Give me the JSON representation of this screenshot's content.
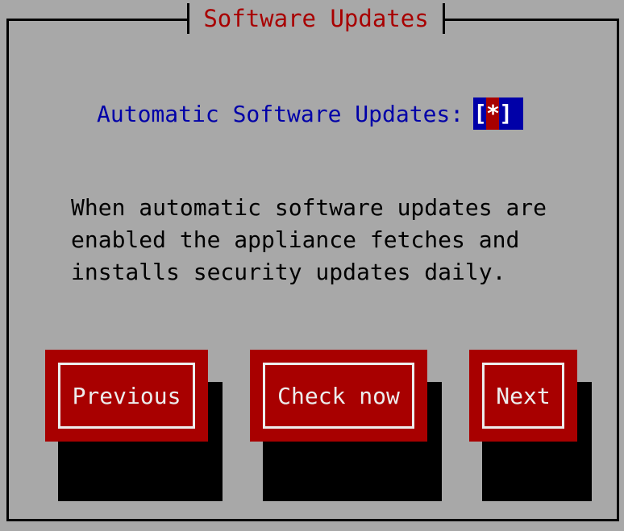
{
  "dialog": {
    "title": "Software Updates",
    "auto_updates_label": "Automatic Software Updates:",
    "auto_updates_checked_mark": "*",
    "description": "When automatic software updates are\nenabled the appliance fetches and\ninstalls security updates daily."
  },
  "buttons": {
    "previous": "Previous",
    "check_now": "Check now",
    "next": "Next"
  },
  "colors": {
    "background": "#a8a8a8",
    "title_text": "#a80000",
    "label_text": "#0000a8",
    "checkbox_background": "#0000a8",
    "checkbox_mark_background": "#a80000",
    "button_background": "#a80000",
    "button_text": "#ededed",
    "shadow": "#000000"
  }
}
